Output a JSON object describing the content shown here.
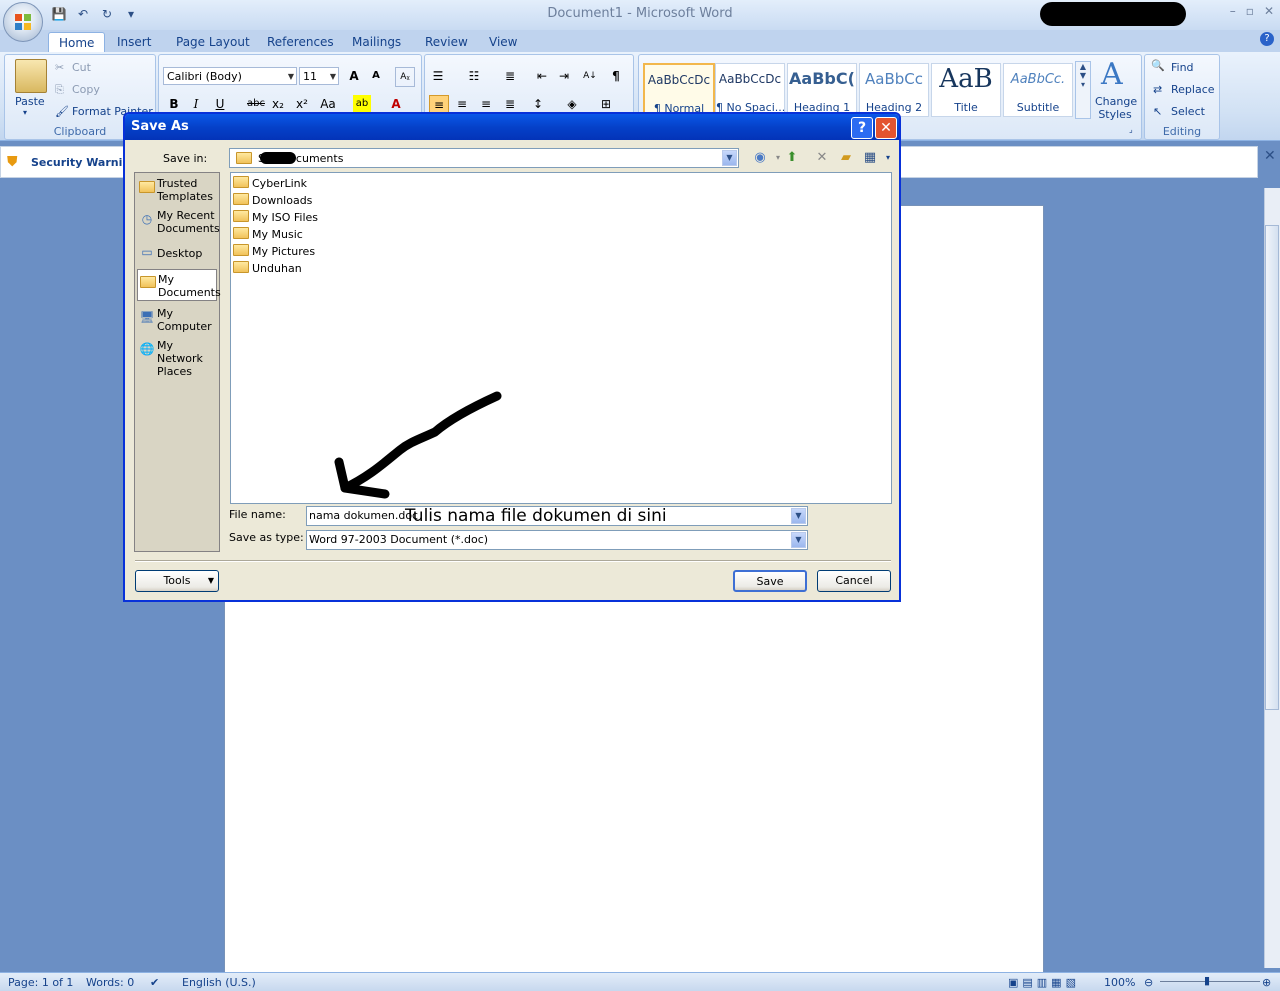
{
  "window": {
    "title": "Document1 - Microsoft Word",
    "controls": [
      "–",
      "▫",
      "✕"
    ]
  },
  "tabs": [
    "Home",
    "Insert",
    "Page Layout",
    "References",
    "Mailings",
    "Review",
    "View"
  ],
  "ribbon": {
    "clipboard": {
      "paste": "Paste",
      "cut": "Cut",
      "copy": "Copy",
      "format_painter": "Format Painter",
      "label": "Clipboard"
    },
    "font": {
      "name": "Calibri (Body)",
      "size": "11",
      "bold": "B",
      "italic": "I",
      "underline": "U",
      "strike": "abc",
      "sub": "x₂",
      "sup": "x²",
      "case": "Aa"
    },
    "styles": [
      {
        "sample": "AaBbCcDc",
        "name": "¶ Normal"
      },
      {
        "sample": "AaBbCcDc",
        "name": "¶ No Spaci..."
      },
      {
        "sample": "AaBbC(",
        "name": "Heading 1"
      },
      {
        "sample": "AaBbCc",
        "name": "Heading 2"
      },
      {
        "sample": "AaB",
        "name": "Title"
      },
      {
        "sample": "AaBbCc.",
        "name": "Subtitle"
      }
    ],
    "change_styles": "Change Styles",
    "editing": {
      "find": "Find",
      "replace": "Replace",
      "select": "Select",
      "label": "Editing"
    }
  },
  "security": {
    "label": "Security Warning"
  },
  "dialog": {
    "title": "Save As",
    "help": "?",
    "close": "✕",
    "save_in_label": "Save in:",
    "save_in_value": "S          's Documents",
    "places": [
      {
        "label": "Trusted Templates"
      },
      {
        "label": "My Recent Documents"
      },
      {
        "label": "Desktop"
      },
      {
        "label": "My Documents"
      },
      {
        "label": "My Computer"
      },
      {
        "label": "My Network Places"
      }
    ],
    "files": [
      "CyberLink",
      "Downloads",
      "My ISO Files",
      "My Music",
      "My Pictures",
      "Unduhan"
    ],
    "file_name_label": "File name:",
    "file_name_value": "nama dokumen.doc",
    "annotation": "Tulis nama file dokumen di sini",
    "save_type_label": "Save as type:",
    "save_type_value": "Word 97-2003 Document (*.doc)",
    "tools": "Tools",
    "save": "Save",
    "cancel": "Cancel"
  },
  "status": {
    "page": "Page: 1 of 1",
    "words": "Words: 0",
    "language": "English (U.S.)",
    "zoom": "100%"
  }
}
